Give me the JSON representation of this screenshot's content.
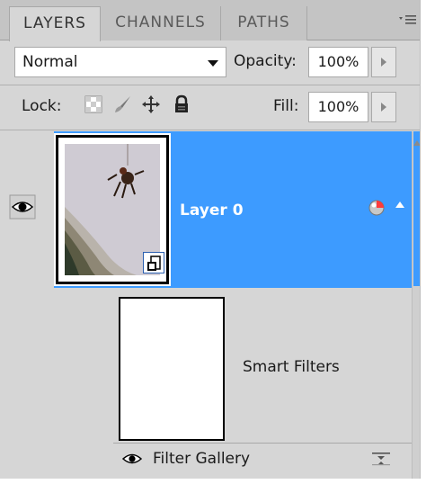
{
  "tabs": [
    {
      "label": "LAYERS",
      "active": true
    },
    {
      "label": "CHANNELS",
      "active": false
    },
    {
      "label": "PATHS",
      "active": false
    }
  ],
  "blend_mode": {
    "value": "Normal"
  },
  "opacity": {
    "label": "Opacity:",
    "value": "100%"
  },
  "lock": {
    "label": "Lock:",
    "icons": [
      "lock-transparent-pixels-icon",
      "lock-image-pixels-icon",
      "lock-position-icon",
      "lock-all-icon"
    ]
  },
  "fill": {
    "label": "Fill:",
    "value": "100%"
  },
  "layers": [
    {
      "name": "Layer 0",
      "selected": true,
      "visible": true,
      "smart_object": true
    },
    {
      "name": "Smart Filters",
      "visible": true
    },
    {
      "name": "Filter Gallery",
      "visible": true
    }
  ],
  "colors": {
    "selection": "#3d9bff",
    "panel": "#d6d6d6",
    "tab_bar": "#c4c4c4"
  }
}
